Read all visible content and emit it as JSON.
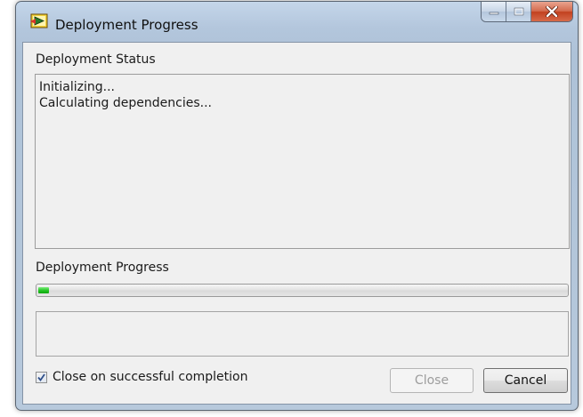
{
  "window": {
    "title": "Deployment Progress",
    "caption_buttons": [
      "minimize",
      "maximize",
      "close"
    ]
  },
  "status": {
    "label": "Deployment Status",
    "lines": [
      "Initializing...",
      "Calculating dependencies..."
    ]
  },
  "progress": {
    "label": "Deployment Progress",
    "value_fraction": 0.02,
    "fill_color": "#22c322"
  },
  "detail_text": "",
  "options": {
    "close_on_success_label": "Close on successful completion",
    "close_on_success_checked": true
  },
  "buttons": {
    "close_label": "Close",
    "close_enabled": false,
    "cancel_label": "Cancel"
  },
  "icons": {
    "app": "labview-deploy-icon",
    "minimize": "minimize-icon",
    "maximize": "maximize-icon",
    "close": "close-icon",
    "check": "check-icon"
  }
}
